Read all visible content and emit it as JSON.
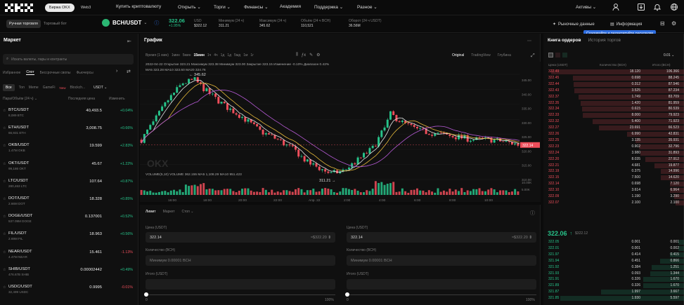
{
  "topnav": {
    "logo": "OKX",
    "tabs": [
      "Биржа OKX",
      "Web3"
    ],
    "items": [
      "Купить криптовалюту",
      "Открыть ⌄",
      "Торги ⌄",
      "Финансы ⌄",
      "Академия",
      "Поддержка ⌄",
      "Разное ⌄"
    ],
    "assets": "Активы ⌄"
  },
  "tickerbar": {
    "modes": [
      "Ручная торговля",
      "Торговый бот"
    ],
    "pair": "BCH/USDT",
    "pair_chevron": "⌄",
    "last_price": "322.06",
    "change": "+1.95%",
    "stats": [
      {
        "label": "USD",
        "value": "$322.12"
      },
      {
        "label": "Минимум (24 ч)",
        "value": "311.21"
      },
      {
        "label": "Максимум (24 ч)",
        "value": "345.62"
      },
      {
        "label": "Объём (24 ч BCH)",
        "value": "110,521"
      },
      {
        "label": "Оборот (24 ч USDT)",
        "value": "36.56M"
      }
    ],
    "market_data": "Рыночные данные",
    "info": "Информация",
    "tooltip": "Создавайте и редактируйте раскладки"
  },
  "market": {
    "title": "Маркет",
    "search_placeholder": "Искать валюты, пары и контракты",
    "tabs": [
      "Избранное",
      "Спот",
      "Бессрочные свопы",
      "Фьючерсы"
    ],
    "filters": [
      "Все",
      "Топ",
      "Meme",
      "GameFi",
      "New",
      "Blockch..."
    ],
    "quote": "USDT ⌄",
    "cols": [
      "Пара/Объём (24 ч) ⌄",
      "Последняя цена",
      "Изменить"
    ],
    "rows": [
      {
        "pair": "BTC/USDT",
        "vol": "8,089 BTC",
        "price": "40,493.5",
        "chg": "+0.04%",
        "up": true
      },
      {
        "pair": "ETH/USDT",
        "vol": "66,931 ETH",
        "price": "3,008.75",
        "chg": "+0.66%",
        "up": true
      },
      {
        "pair": "OKB/USDT",
        "vol": "1.47M OKB",
        "price": "19.599",
        "chg": "+2.83%",
        "up": true
      },
      {
        "pair": "OKT/USDT",
        "vol": "99,186 OKT",
        "price": "45.67",
        "chg": "+1.22%",
        "up": true
      },
      {
        "pair": "LTC/USDT",
        "vol": "280,463 LTC",
        "price": "107.64",
        "chg": "+0.87%",
        "up": true
      },
      {
        "pair": "DOT/USDT",
        "vol": "2.66M DOT",
        "price": "18.328",
        "chg": "+0.85%",
        "up": true
      },
      {
        "pair": "DOGE/USDT",
        "vol": "537.09M DOGE",
        "price": "0.137001",
        "chg": "+0.52%",
        "up": true
      },
      {
        "pair": "FIL/USDT",
        "vol": "2.69M FIL",
        "price": "18.963",
        "chg": "+0.56%",
        "up": true
      },
      {
        "pair": "NEAR/USDT",
        "vol": "4.47M NEAR",
        "price": "15.461",
        "chg": "-1.13%",
        "up": false
      },
      {
        "pair": "SHIB/USDT",
        "vol": "476.67B SHIB",
        "price": "0.00002442",
        "chg": "+0.49%",
        "up": true
      },
      {
        "pair": "USDC/USDT",
        "vol": "32,499 USDC",
        "price": "0.9995",
        "chg": "-0.01%",
        "up": false
      }
    ]
  },
  "chart": {
    "title": "График",
    "intervals": [
      "Время (1 мин)",
      "1мин",
      "5мин",
      "15мин",
      "1ч",
      "4ч",
      "1д",
      "1д",
      "5мд",
      "1м",
      "1г"
    ],
    "views": [
      "Original",
      "TradingView",
      "Глубина"
    ],
    "ohlc_line": "2022-04-22  Открытие 323.21  Максимум 323.38  Минимум 323.00  Закрытие 323.15  Изменение -0.10%  Диапазон 0.42%",
    "ma_line": "MA5 323.28  MA10 323.60  MA20 324.76",
    "volume_line": "VOLUME(5,10)  VOLUME 362.155  MA5 1,108.29  MA10 951.423",
    "hi_label": "345.62",
    "lo_label": "311.21",
    "price_tag": "322.14",
    "axis_prices": [
      "345.00",
      "340.00",
      "335.00",
      "330.00",
      "325.00",
      "320.00",
      "315.00",
      "310.00"
    ],
    "vol_axis": [
      "10.00K",
      "5.00K"
    ],
    "time_axis": [
      "16:00",
      "18:00",
      "20:00",
      "22:00",
      "Апр. 22",
      "2:00",
      "4:00",
      "6:00",
      "8:00",
      "10:00"
    ],
    "watermark": "OKX"
  },
  "order": {
    "tabs": [
      "Лимит",
      "Маркет",
      "Стоп ⌄"
    ],
    "buy": {
      "price_label": "Цена (USDT)",
      "price": "322.14",
      "price_hint": "≈$322.20",
      "qty_label": "Количество (BCH)",
      "qty_placeholder": "Минимум 0.00001 BCH",
      "total_label": "Итого (USDT)",
      "pct": [
        "0",
        "100%"
      ]
    },
    "sell": {
      "price_label": "Цена (USDT)",
      "price": "322.14",
      "price_hint": "≈$322.20",
      "qty_label": "Количество (BCH)",
      "qty_placeholder": "Минимум 0.00001 BCH",
      "total_label": "Итого (USDT)",
      "pct": [
        "0",
        "100%"
      ]
    }
  },
  "book": {
    "tabs": [
      "Книга ордеров",
      "История торгов"
    ],
    "step": "0.01 ⌄",
    "cols": [
      "Цена (USDT)",
      "Количество (BCH)",
      "Итого (BCH)"
    ],
    "asks": [
      [
        "322.49",
        "18.120",
        "106.366"
      ],
      [
        "322.45",
        "0.698",
        "88.245"
      ],
      [
        "322.44",
        "0.312",
        "87.546"
      ],
      [
        "322.43",
        "3.525",
        "87.234"
      ],
      [
        "322.37",
        "1.749",
        "83.709"
      ],
      [
        "322.35",
        "1.420",
        "81.959"
      ],
      [
        "322.34",
        "0.615",
        "80.539"
      ],
      [
        "322.33",
        "8.000",
        "79.923"
      ],
      [
        "322.32",
        "5.400",
        "71.923"
      ],
      [
        "322.27",
        "23.691",
        "66.523"
      ],
      [
        "322.26",
        "6.990",
        "42.831"
      ],
      [
        "322.25",
        "3.135",
        "35.931"
      ],
      [
        "322.23",
        "0.902",
        "32.796"
      ],
      [
        "322.24",
        "3.980",
        "31.893"
      ],
      [
        "322.20",
        "8.035",
        "27.912"
      ],
      [
        "322.21",
        "4.681",
        "19.877"
      ],
      [
        "322.19",
        "0.375",
        "14.996"
      ],
      [
        "322.15",
        "7.500",
        "14.620"
      ],
      [
        "322.14",
        "0.698",
        "7.120"
      ],
      [
        "322.10",
        "3.614",
        "6.964"
      ],
      [
        "322.09",
        "1.190",
        "3.290"
      ],
      [
        "322.07",
        "2.100",
        "2.100"
      ]
    ],
    "mid_price": "322.06",
    "mid_usd": "$322.12",
    "bids": [
      [
        "322.05",
        "0.001",
        "0.001"
      ],
      [
        "322.01",
        "0.001",
        "0.002"
      ],
      [
        "321.97",
        "0.414",
        "0.415"
      ],
      [
        "321.94",
        "0.451",
        "0.866"
      ],
      [
        "321.92",
        "0.384",
        "1.251"
      ],
      [
        "321.93",
        "0.093",
        "1.344"
      ],
      [
        "321.91",
        "0.326",
        "1.670"
      ],
      [
        "321.89",
        "0.326",
        "1.670"
      ],
      [
        "321.87",
        "1.997",
        "3.667"
      ],
      [
        "321.85",
        "1.930",
        "5.597"
      ]
    ]
  },
  "colors": {
    "up": "#27c38a",
    "down": "#ef4e5b",
    "bg": "#0b0b0b",
    "accent": "#2d6cdf"
  },
  "chart_data": {
    "type": "candlestick",
    "ylim": [
      310,
      347
    ],
    "ma_series": [
      "MA5",
      "MA10",
      "MA20"
    ]
  }
}
